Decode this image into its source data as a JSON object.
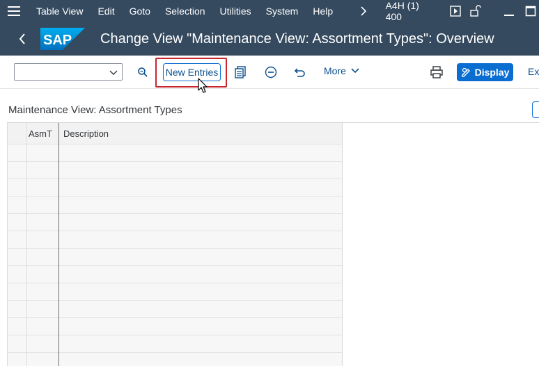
{
  "menubar": {
    "items": [
      {
        "label": "Table View"
      },
      {
        "label": "Edit"
      },
      {
        "label": "Goto"
      },
      {
        "label": "Selection"
      },
      {
        "label": "Utilities"
      },
      {
        "label": "System"
      },
      {
        "label": "Help"
      }
    ],
    "system_info": "A4H (1) 400",
    "icons": [
      "hamburger-icon",
      "chevron-right-icon",
      "play-icon",
      "lock-open-icon",
      "minimize-icon",
      "maximize-icon"
    ]
  },
  "titlebar": {
    "logo_text": "SAP",
    "title": "Change View \"Maintenance View: Assortment Types\": Overview"
  },
  "toolbar": {
    "command_field_value": "",
    "new_entries_label": "New Entries",
    "more_label": "More",
    "display_label": "Display",
    "exit_label": "Ex",
    "icons": [
      "search-icon",
      "copy-icon",
      "delete-icon",
      "undo-icon",
      "print-icon",
      "chevron-down-icon"
    ]
  },
  "content": {
    "section_title": "Maintenance View: Assortment Types",
    "columns": [
      {
        "label": ""
      },
      {
        "label": "AsmT"
      },
      {
        "label": "Description"
      }
    ],
    "rows": [
      {
        "asmt": "",
        "description": ""
      },
      {
        "asmt": "",
        "description": ""
      },
      {
        "asmt": "",
        "description": ""
      },
      {
        "asmt": "",
        "description": ""
      },
      {
        "asmt": "",
        "description": ""
      },
      {
        "asmt": "",
        "description": ""
      },
      {
        "asmt": "",
        "description": ""
      },
      {
        "asmt": "",
        "description": ""
      },
      {
        "asmt": "",
        "description": ""
      },
      {
        "asmt": "",
        "description": ""
      },
      {
        "asmt": "",
        "description": ""
      },
      {
        "asmt": "",
        "description": ""
      },
      {
        "asmt": "",
        "description": ""
      }
    ]
  },
  "colors": {
    "shell_bg": "#354a5f",
    "accent": "#0a6ed1",
    "highlight": "#c8262d"
  }
}
